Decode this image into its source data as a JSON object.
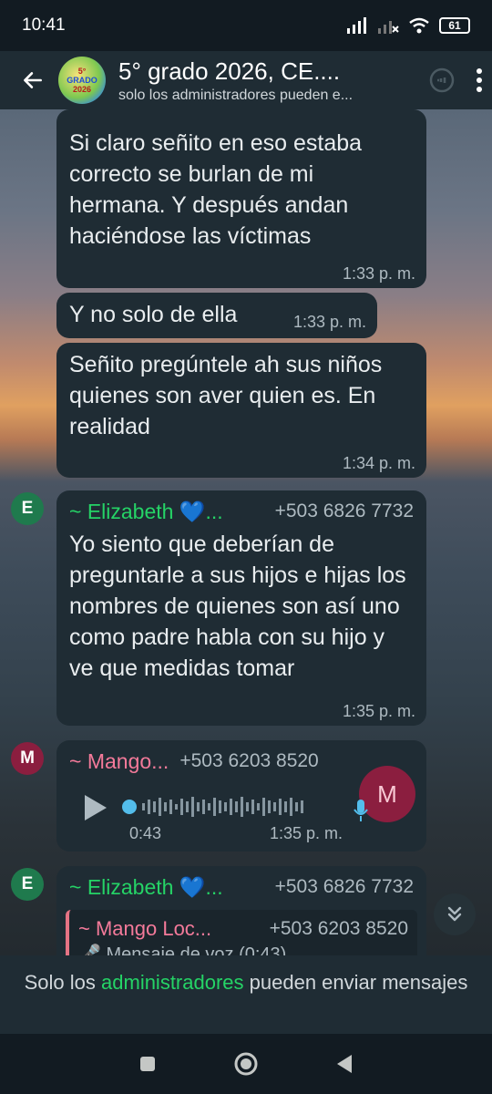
{
  "status_bar": {
    "time": "10:41",
    "battery": "61"
  },
  "header": {
    "avatar_text_1": "5°",
    "avatar_text_2": "GRADO",
    "avatar_text_3": "2026",
    "title": "5° grado 2026, CE....",
    "subtitle": "solo los administradores pueden e..."
  },
  "messages": [
    {
      "text": "Si claro  señito en eso estaba correcto  se burlan de mi hermana. Y después  andan haciéndose las víctimas",
      "time": "1:33 p. m."
    },
    {
      "text": "Y no solo de ella",
      "time": "1:33 p. m."
    },
    {
      "text": "Señito pregúntele ah sus niños  quienes son aver quien es. En realidad",
      "time": "1:34 p. m."
    },
    {
      "avatar": "E",
      "sender": "~ Elizabeth 💙...",
      "phone": "+503 6826 7732",
      "text": "Yo siento que deberían de preguntarle a sus hijos e hijas los nombres de quienes son así uno como padre habla con su hijo y ve que medidas tomar",
      "time": "1:35 p. m."
    },
    {
      "avatar": "M",
      "sender": "~ Mango...",
      "phone": "+503 6203 8520",
      "voice_duration": "0:43",
      "time": "1:35 p. m.",
      "voice_avatar": "M"
    },
    {
      "avatar": "E",
      "sender": "~ Elizabeth 💙...",
      "phone": "+503 6826 7732",
      "quote_sender": "~ Mango Loc...",
      "quote_phone": "+503 6203 8520",
      "quote_text": "🎤 Mensaje de voz (0:43)"
    }
  ],
  "footer": {
    "before": "Solo los ",
    "link": "administradores",
    "after": " pueden enviar mensajes"
  },
  "colors": {
    "elizabeth": "#25d366",
    "mango": "#f47a9a",
    "bubble": "#1f2c34",
    "header": "#1f2c34",
    "accent": "#25d366"
  }
}
